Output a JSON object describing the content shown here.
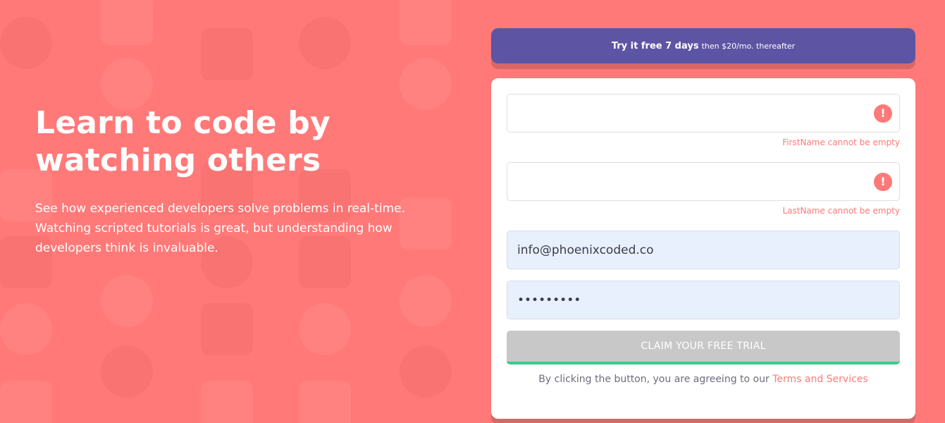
{
  "hero": {
    "headline": "Learn to code by watching others",
    "subtext": "See how experienced developers solve problems in real-time. Watching scripted tutorials is great, but understanding how developers think is invaluable."
  },
  "banner": {
    "bold_text": "Try it free 7 days",
    "light_text": "then $20/mo. thereafter"
  },
  "form": {
    "first_name": {
      "value": "",
      "placeholder": "",
      "error": "FirstName cannot be empty"
    },
    "last_name": {
      "value": "",
      "placeholder": "",
      "error": "LastName cannot be empty"
    },
    "email": {
      "value": "info@phoenixcoded.co"
    },
    "password": {
      "value": "123456789"
    },
    "error_icon_glyph": "!",
    "submit_label": "CLAIM YOUR FREE TRIAL",
    "terms_prefix": "By clicking the button, you are agreeing to our ",
    "terms_link": "Terms and Services"
  },
  "colors": {
    "background": "#ff7978",
    "banner": "#5e54a4",
    "error": "#ff7978",
    "submit_disabled": "#c8c8c8",
    "submit_accent": "#38cc8b",
    "autofill": "#e8f0fe"
  },
  "icons": {
    "error": "exclamation-circle-icon",
    "background": "developer-pattern-icons"
  }
}
